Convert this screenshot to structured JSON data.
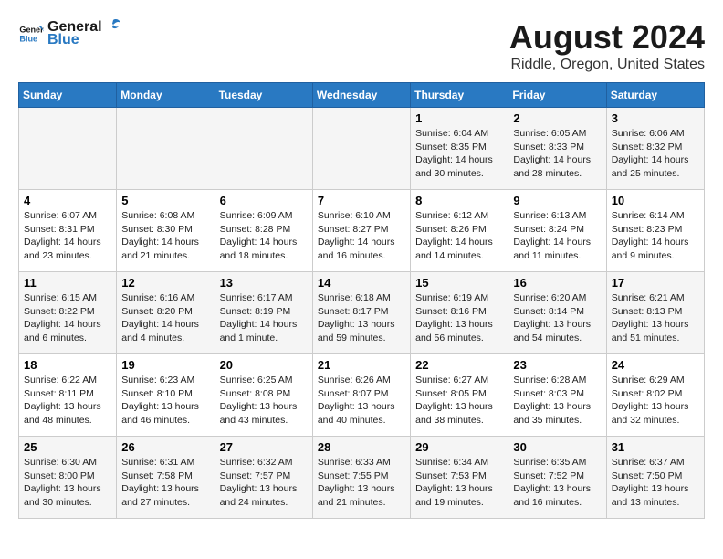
{
  "header": {
    "logo_line1": "General",
    "logo_line2": "Blue",
    "title": "August 2024",
    "subtitle": "Riddle, Oregon, United States"
  },
  "days_of_week": [
    "Sunday",
    "Monday",
    "Tuesday",
    "Wednesday",
    "Thursday",
    "Friday",
    "Saturday"
  ],
  "weeks": [
    [
      {
        "day": "",
        "info": ""
      },
      {
        "day": "",
        "info": ""
      },
      {
        "day": "",
        "info": ""
      },
      {
        "day": "",
        "info": ""
      },
      {
        "day": "1",
        "info": "Sunrise: 6:04 AM\nSunset: 8:35 PM\nDaylight: 14 hours\nand 30 minutes."
      },
      {
        "day": "2",
        "info": "Sunrise: 6:05 AM\nSunset: 8:33 PM\nDaylight: 14 hours\nand 28 minutes."
      },
      {
        "day": "3",
        "info": "Sunrise: 6:06 AM\nSunset: 8:32 PM\nDaylight: 14 hours\nand 25 minutes."
      }
    ],
    [
      {
        "day": "4",
        "info": "Sunrise: 6:07 AM\nSunset: 8:31 PM\nDaylight: 14 hours\nand 23 minutes."
      },
      {
        "day": "5",
        "info": "Sunrise: 6:08 AM\nSunset: 8:30 PM\nDaylight: 14 hours\nand 21 minutes."
      },
      {
        "day": "6",
        "info": "Sunrise: 6:09 AM\nSunset: 8:28 PM\nDaylight: 14 hours\nand 18 minutes."
      },
      {
        "day": "7",
        "info": "Sunrise: 6:10 AM\nSunset: 8:27 PM\nDaylight: 14 hours\nand 16 minutes."
      },
      {
        "day": "8",
        "info": "Sunrise: 6:12 AM\nSunset: 8:26 PM\nDaylight: 14 hours\nand 14 minutes."
      },
      {
        "day": "9",
        "info": "Sunrise: 6:13 AM\nSunset: 8:24 PM\nDaylight: 14 hours\nand 11 minutes."
      },
      {
        "day": "10",
        "info": "Sunrise: 6:14 AM\nSunset: 8:23 PM\nDaylight: 14 hours\nand 9 minutes."
      }
    ],
    [
      {
        "day": "11",
        "info": "Sunrise: 6:15 AM\nSunset: 8:22 PM\nDaylight: 14 hours\nand 6 minutes."
      },
      {
        "day": "12",
        "info": "Sunrise: 6:16 AM\nSunset: 8:20 PM\nDaylight: 14 hours\nand 4 minutes."
      },
      {
        "day": "13",
        "info": "Sunrise: 6:17 AM\nSunset: 8:19 PM\nDaylight: 14 hours\nand 1 minute."
      },
      {
        "day": "14",
        "info": "Sunrise: 6:18 AM\nSunset: 8:17 PM\nDaylight: 13 hours\nand 59 minutes."
      },
      {
        "day": "15",
        "info": "Sunrise: 6:19 AM\nSunset: 8:16 PM\nDaylight: 13 hours\nand 56 minutes."
      },
      {
        "day": "16",
        "info": "Sunrise: 6:20 AM\nSunset: 8:14 PM\nDaylight: 13 hours\nand 54 minutes."
      },
      {
        "day": "17",
        "info": "Sunrise: 6:21 AM\nSunset: 8:13 PM\nDaylight: 13 hours\nand 51 minutes."
      }
    ],
    [
      {
        "day": "18",
        "info": "Sunrise: 6:22 AM\nSunset: 8:11 PM\nDaylight: 13 hours\nand 48 minutes."
      },
      {
        "day": "19",
        "info": "Sunrise: 6:23 AM\nSunset: 8:10 PM\nDaylight: 13 hours\nand 46 minutes."
      },
      {
        "day": "20",
        "info": "Sunrise: 6:25 AM\nSunset: 8:08 PM\nDaylight: 13 hours\nand 43 minutes."
      },
      {
        "day": "21",
        "info": "Sunrise: 6:26 AM\nSunset: 8:07 PM\nDaylight: 13 hours\nand 40 minutes."
      },
      {
        "day": "22",
        "info": "Sunrise: 6:27 AM\nSunset: 8:05 PM\nDaylight: 13 hours\nand 38 minutes."
      },
      {
        "day": "23",
        "info": "Sunrise: 6:28 AM\nSunset: 8:03 PM\nDaylight: 13 hours\nand 35 minutes."
      },
      {
        "day": "24",
        "info": "Sunrise: 6:29 AM\nSunset: 8:02 PM\nDaylight: 13 hours\nand 32 minutes."
      }
    ],
    [
      {
        "day": "25",
        "info": "Sunrise: 6:30 AM\nSunset: 8:00 PM\nDaylight: 13 hours\nand 30 minutes."
      },
      {
        "day": "26",
        "info": "Sunrise: 6:31 AM\nSunset: 7:58 PM\nDaylight: 13 hours\nand 27 minutes."
      },
      {
        "day": "27",
        "info": "Sunrise: 6:32 AM\nSunset: 7:57 PM\nDaylight: 13 hours\nand 24 minutes."
      },
      {
        "day": "28",
        "info": "Sunrise: 6:33 AM\nSunset: 7:55 PM\nDaylight: 13 hours\nand 21 minutes."
      },
      {
        "day": "29",
        "info": "Sunrise: 6:34 AM\nSunset: 7:53 PM\nDaylight: 13 hours\nand 19 minutes."
      },
      {
        "day": "30",
        "info": "Sunrise: 6:35 AM\nSunset: 7:52 PM\nDaylight: 13 hours\nand 16 minutes."
      },
      {
        "day": "31",
        "info": "Sunrise: 6:37 AM\nSunset: 7:50 PM\nDaylight: 13 hours\nand 13 minutes."
      }
    ]
  ]
}
